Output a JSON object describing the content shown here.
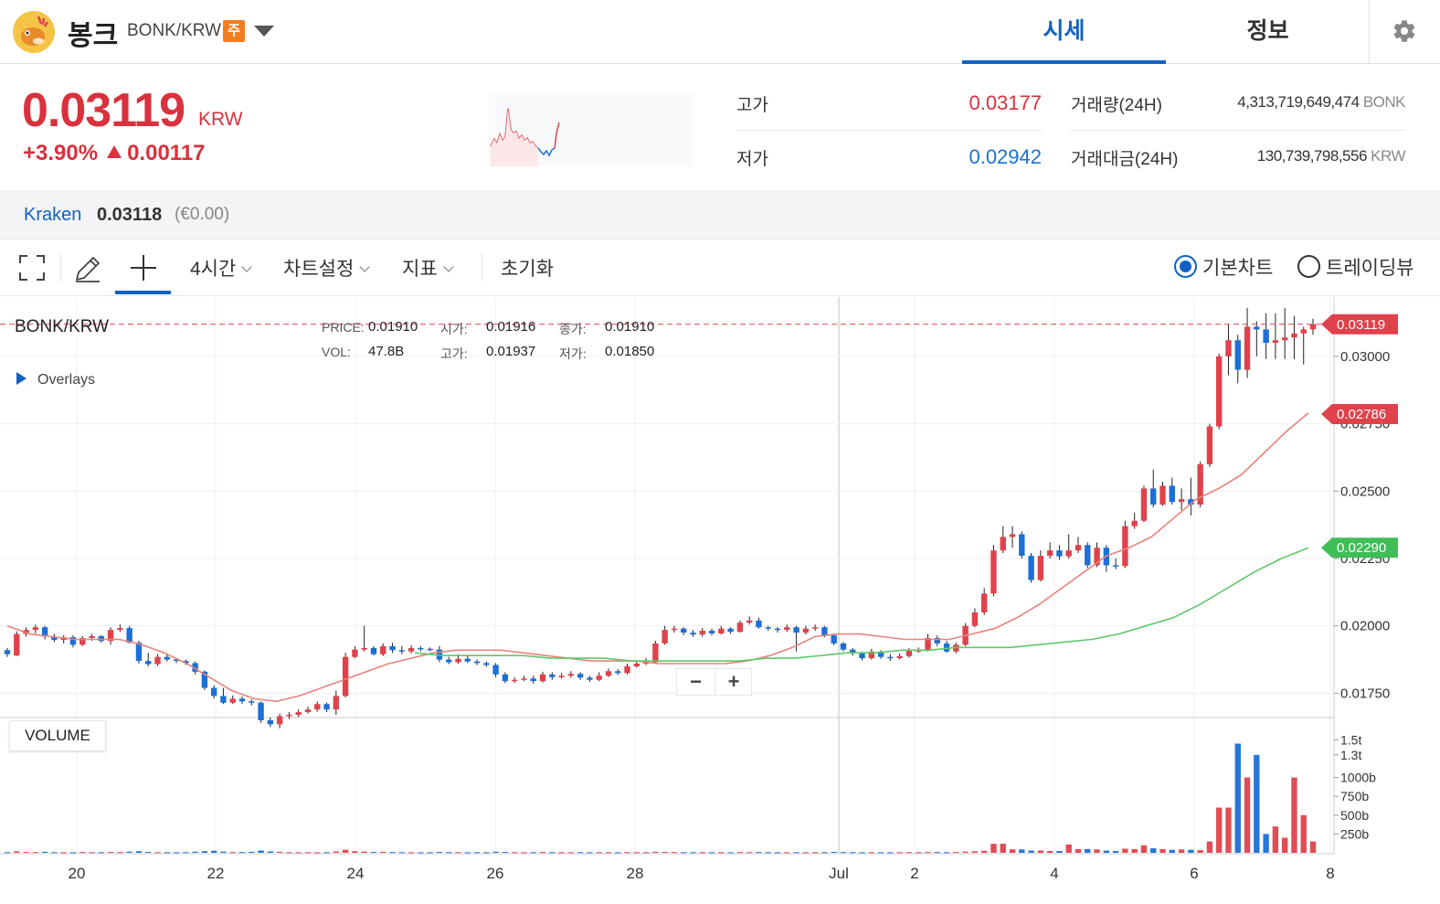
{
  "header": {
    "coin_name": "봉크",
    "pair": "BONK/KRW",
    "badge": "주",
    "tabs": [
      {
        "label": "시세",
        "active": true
      },
      {
        "label": "정보",
        "active": false
      }
    ]
  },
  "price": {
    "current": "0.03119",
    "unit": "KRW",
    "change_pct": "+3.90%",
    "change_amt": "0.00117",
    "high_label": "고가",
    "high": "0.03177",
    "low_label": "저가",
    "low": "0.02942",
    "volume_label": "거래량(24H)",
    "volume": "4,313,719,649,474",
    "volume_unit": "BONK",
    "turnover_label": "거래대금(24H)",
    "turnover": "130,739,798,556",
    "turnover_unit": "KRW"
  },
  "exchange": {
    "name": "Kraken",
    "price": "0.03118",
    "diff": "(€0.00)"
  },
  "toolbar": {
    "interval": "4시간",
    "chart_settings": "차트설정",
    "indicators": "지표",
    "reset": "초기화",
    "basic_chart": "기본차트",
    "tradingview": "트레이딩뷰"
  },
  "chart_legend": {
    "symbol": "BONK/KRW",
    "price_label": "PRICE:",
    "price": "0.01910",
    "open_label": "시가:",
    "open": "0.01916",
    "close_label": "종가:",
    "close": "0.01910",
    "vol_label": "VOL:",
    "vol": "47.8B",
    "high_label": "고가:",
    "high": "0.01937",
    "low_label": "저가:",
    "low": "0.01850",
    "overlays": "Overlays",
    "volume_panel": "VOLUME"
  },
  "colors": {
    "up": "#e0424c",
    "down": "#1c6fd8",
    "ma_short": "#e8837c",
    "ma_long": "#5fc86a",
    "accent": "#1261c4"
  },
  "chart_data": {
    "type": "candlestick",
    "ylim": [
      0.0166,
      0.0322
    ],
    "price_ticks": [
      "0.03000",
      "0.02750",
      "0.02500",
      "0.02250",
      "0.02000",
      "0.01750"
    ],
    "price_tick_values": [
      0.03,
      0.0275,
      0.025,
      0.0225,
      0.02,
      0.0175
    ],
    "price_tags": [
      {
        "label": "0.03119",
        "value": 0.03119,
        "color": "#e0424c"
      },
      {
        "label": "0.02786",
        "value": 0.02786,
        "color": "#e0424c"
      },
      {
        "label": "0.02290",
        "value": 0.0229,
        "color": "#3fbe58"
      }
    ],
    "x_labels": [
      "20",
      "22",
      "24",
      "26",
      "28",
      "Jul",
      "2",
      "4",
      "6",
      "8"
    ],
    "volume_ticks": [
      "1.5t",
      "1.3t",
      "1000b",
      "750b",
      "500b",
      "250b"
    ],
    "volume_tick_values": [
      1500,
      1300,
      1000,
      750,
      500,
      250
    ],
    "candles": [
      [
        0.0191,
        0.01895,
        0.01918,
        0.01885,
        8
      ],
      [
        0.0189,
        0.0197,
        0.0198,
        0.01888,
        20
      ],
      [
        0.0197,
        0.01985,
        0.01995,
        0.0196,
        12
      ],
      [
        0.01985,
        0.01995,
        0.02005,
        0.01972,
        10
      ],
      [
        0.01995,
        0.0196,
        0.02,
        0.0195,
        14
      ],
      [
        0.0196,
        0.01948,
        0.0197,
        0.0194,
        9
      ],
      [
        0.01948,
        0.01958,
        0.01965,
        0.01935,
        8
      ],
      [
        0.01958,
        0.0193,
        0.01965,
        0.0192,
        7
      ],
      [
        0.0193,
        0.01955,
        0.01962,
        0.01925,
        11
      ],
      [
        0.01955,
        0.01962,
        0.0197,
        0.01945,
        9
      ],
      [
        0.01962,
        0.01944,
        0.01966,
        0.01938,
        8
      ],
      [
        0.01944,
        0.01985,
        0.01995,
        0.0193,
        12
      ],
      [
        0.01985,
        0.01992,
        0.02005,
        0.01978,
        10
      ],
      [
        0.01992,
        0.01938,
        0.02,
        0.01935,
        15
      ],
      [
        0.01938,
        0.0187,
        0.01945,
        0.0186,
        22
      ],
      [
        0.0187,
        0.01858,
        0.019,
        0.0185,
        12
      ],
      [
        0.01858,
        0.01885,
        0.01895,
        0.01852,
        9
      ],
      [
        0.01885,
        0.01875,
        0.01895,
        0.01868,
        8
      ],
      [
        0.01875,
        0.0187,
        0.0188,
        0.01862,
        7
      ],
      [
        0.0187,
        0.01862,
        0.01875,
        0.01855,
        9
      ],
      [
        0.01862,
        0.0183,
        0.01868,
        0.0182,
        15
      ],
      [
        0.0183,
        0.0177,
        0.01835,
        0.01762,
        22
      ],
      [
        0.0177,
        0.0174,
        0.0178,
        0.0173,
        28
      ],
      [
        0.0174,
        0.01715,
        0.0177,
        0.0171,
        16
      ],
      [
        0.01715,
        0.0173,
        0.01742,
        0.0171,
        10
      ],
      [
        0.0173,
        0.0172,
        0.01738,
        0.0171,
        11
      ],
      [
        0.0172,
        0.01715,
        0.01728,
        0.01705,
        13
      ],
      [
        0.01715,
        0.0165,
        0.0172,
        0.0164,
        30
      ],
      [
        0.0165,
        0.01635,
        0.0166,
        0.01625,
        18
      ],
      [
        0.01635,
        0.01665,
        0.01675,
        0.0162,
        14
      ],
      [
        0.01665,
        0.0167,
        0.0168,
        0.01655,
        9
      ],
      [
        0.0167,
        0.0168,
        0.0169,
        0.01662,
        8
      ],
      [
        0.0168,
        0.0169,
        0.017,
        0.01675,
        9
      ],
      [
        0.0169,
        0.0171,
        0.0172,
        0.01682,
        7
      ],
      [
        0.0171,
        0.0169,
        0.01715,
        0.0168,
        8
      ],
      [
        0.0169,
        0.0174,
        0.0176,
        0.0167,
        18
      ],
      [
        0.0174,
        0.01885,
        0.019,
        0.01735,
        40
      ],
      [
        0.01885,
        0.01912,
        0.01925,
        0.0188,
        22
      ],
      [
        0.01912,
        0.01918,
        0.02,
        0.01905,
        16
      ],
      [
        0.01918,
        0.01895,
        0.01925,
        0.0189,
        12
      ],
      [
        0.01895,
        0.01925,
        0.01935,
        0.01888,
        14
      ],
      [
        0.01925,
        0.0191,
        0.01937,
        0.019,
        11
      ],
      [
        0.0191,
        0.01905,
        0.01925,
        0.01895,
        9
      ],
      [
        0.01905,
        0.01918,
        0.01928,
        0.01898,
        8
      ],
      [
        0.01918,
        0.01915,
        0.01925,
        0.01905,
        7
      ],
      [
        0.01915,
        0.01912,
        0.0192,
        0.01905,
        8
      ],
      [
        0.01912,
        0.01875,
        0.01925,
        0.01865,
        12
      ],
      [
        0.01875,
        0.01865,
        0.01885,
        0.01858,
        9
      ],
      [
        0.01865,
        0.01878,
        0.01895,
        0.0186,
        10
      ],
      [
        0.01878,
        0.01868,
        0.0189,
        0.01862,
        8
      ],
      [
        0.01868,
        0.01862,
        0.01875,
        0.01855,
        9
      ],
      [
        0.01862,
        0.01855,
        0.01868,
        0.01848,
        8
      ],
      [
        0.01855,
        0.0182,
        0.01862,
        0.0181,
        15
      ],
      [
        0.0182,
        0.01795,
        0.01828,
        0.01788,
        12
      ],
      [
        0.01795,
        0.018,
        0.0181,
        0.01788,
        9
      ],
      [
        0.018,
        0.01805,
        0.01815,
        0.01795,
        8
      ],
      [
        0.01805,
        0.01795,
        0.01815,
        0.01785,
        9
      ],
      [
        0.01795,
        0.0182,
        0.0183,
        0.0179,
        11
      ],
      [
        0.0182,
        0.0181,
        0.01828,
        0.018,
        9
      ],
      [
        0.0181,
        0.01815,
        0.01825,
        0.01805,
        8
      ],
      [
        0.01815,
        0.01822,
        0.01832,
        0.01808,
        8
      ],
      [
        0.01822,
        0.01808,
        0.01828,
        0.018,
        9
      ],
      [
        0.01808,
        0.018,
        0.01815,
        0.01792,
        8
      ],
      [
        0.018,
        0.01815,
        0.01828,
        0.01795,
        9
      ],
      [
        0.01815,
        0.01832,
        0.01842,
        0.0181,
        8
      ],
      [
        0.01832,
        0.01825,
        0.0184,
        0.01818,
        7
      ],
      [
        0.01825,
        0.0185,
        0.0186,
        0.0182,
        10
      ],
      [
        0.0185,
        0.0186,
        0.0187,
        0.01845,
        9
      ],
      [
        0.0186,
        0.01865,
        0.0188,
        0.01855,
        8
      ],
      [
        0.01865,
        0.01935,
        0.01945,
        0.0186,
        14
      ],
      [
        0.01935,
        0.01985,
        0.02,
        0.0193,
        12
      ],
      [
        0.01985,
        0.0199,
        0.02,
        0.01975,
        10
      ],
      [
        0.0199,
        0.01975,
        0.01995,
        0.01965,
        9
      ],
      [
        0.01975,
        0.01968,
        0.01985,
        0.0196,
        8
      ],
      [
        0.01968,
        0.01982,
        0.01992,
        0.0196,
        9
      ],
      [
        0.01982,
        0.01972,
        0.0199,
        0.01965,
        8
      ],
      [
        0.01972,
        0.0199,
        0.02,
        0.01968,
        9
      ],
      [
        0.0199,
        0.01978,
        0.01995,
        0.0197,
        7
      ],
      [
        0.01978,
        0.02012,
        0.0202,
        0.01975,
        10
      ],
      [
        0.02012,
        0.0202,
        0.02035,
        0.02005,
        9
      ],
      [
        0.0202,
        0.01995,
        0.0203,
        0.0199,
        11
      ],
      [
        0.01995,
        0.0199,
        0.02,
        0.01982,
        8
      ],
      [
        0.0199,
        0.01985,
        0.01995,
        0.01975,
        7
      ],
      [
        0.01985,
        0.01995,
        0.02005,
        0.01978,
        8
      ],
      [
        0.01995,
        0.01975,
        0.02,
        0.01905,
        9
      ],
      [
        0.01975,
        0.0199,
        0.02,
        0.01968,
        7
      ],
      [
        0.0199,
        0.01995,
        0.02005,
        0.01982,
        8
      ],
      [
        0.01995,
        0.01965,
        0.02,
        0.01958,
        9
      ],
      [
        0.01965,
        0.01935,
        0.01972,
        0.01928,
        12
      ],
      [
        0.01935,
        0.01912,
        0.0194,
        0.01905,
        11
      ],
      [
        0.01912,
        0.01898,
        0.01918,
        0.0189,
        9
      ],
      [
        0.01898,
        0.0188,
        0.01905,
        0.01872,
        8
      ],
      [
        0.0188,
        0.01905,
        0.01915,
        0.01875,
        9
      ],
      [
        0.01905,
        0.01885,
        0.0191,
        0.01878,
        8
      ],
      [
        0.01885,
        0.0188,
        0.01895,
        0.0187,
        7
      ],
      [
        0.0188,
        0.01888,
        0.01898,
        0.01875,
        8
      ],
      [
        0.01888,
        0.01908,
        0.01918,
        0.01882,
        9
      ],
      [
        0.01908,
        0.0191,
        0.0192,
        0.019,
        8
      ],
      [
        0.0191,
        0.01955,
        0.0197,
        0.01905,
        11
      ],
      [
        0.01955,
        0.01935,
        0.01965,
        0.01925,
        10
      ],
      [
        0.01935,
        0.01905,
        0.01945,
        0.019,
        9
      ],
      [
        0.01905,
        0.0193,
        0.01938,
        0.01898,
        11
      ],
      [
        0.0193,
        0.02,
        0.0201,
        0.01925,
        16
      ],
      [
        0.02,
        0.0205,
        0.02065,
        0.01995,
        20
      ],
      [
        0.0205,
        0.0212,
        0.0214,
        0.0204,
        28
      ],
      [
        0.0212,
        0.0228,
        0.023,
        0.0211,
        120
      ],
      [
        0.0228,
        0.0233,
        0.0237,
        0.0227,
        120
      ],
      [
        0.0233,
        0.0234,
        0.0237,
        0.0229,
        45
      ],
      [
        0.0234,
        0.0226,
        0.0235,
        0.0225,
        45
      ],
      [
        0.0226,
        0.0217,
        0.0227,
        0.0216,
        30
      ],
      [
        0.0217,
        0.0226,
        0.0228,
        0.02165,
        30
      ],
      [
        0.0226,
        0.0228,
        0.0231,
        0.0225,
        25
      ],
      [
        0.0228,
        0.02258,
        0.023,
        0.02245,
        24
      ],
      [
        0.02258,
        0.0228,
        0.0234,
        0.0225,
        110
      ],
      [
        0.0228,
        0.023,
        0.0233,
        0.0227,
        50
      ],
      [
        0.023,
        0.02225,
        0.0231,
        0.02215,
        50
      ],
      [
        0.02225,
        0.0229,
        0.0231,
        0.02218,
        45
      ],
      [
        0.0229,
        0.02225,
        0.023,
        0.022,
        30
      ],
      [
        0.02225,
        0.02222,
        0.0225,
        0.0221,
        25
      ],
      [
        0.02222,
        0.0237,
        0.0239,
        0.02215,
        55
      ],
      [
        0.0237,
        0.0239,
        0.0242,
        0.0236,
        50
      ],
      [
        0.0239,
        0.0251,
        0.0252,
        0.02385,
        100
      ],
      [
        0.0251,
        0.0245,
        0.0258,
        0.0244,
        60
      ],
      [
        0.0245,
        0.0252,
        0.02535,
        0.02445,
        50
      ],
      [
        0.0252,
        0.0246,
        0.0255,
        0.0245,
        40
      ],
      [
        0.0246,
        0.0247,
        0.0251,
        0.0243,
        45
      ],
      [
        0.0247,
        0.0245,
        0.0255,
        0.0241,
        40
      ],
      [
        0.0245,
        0.026,
        0.0261,
        0.0244,
        35
      ],
      [
        0.026,
        0.0274,
        0.0275,
        0.0259,
        150
      ],
      [
        0.0274,
        0.03,
        0.0301,
        0.0273,
        600
      ],
      [
        0.03,
        0.0306,
        0.0312,
        0.0293,
        600
      ],
      [
        0.0306,
        0.0295,
        0.0308,
        0.029,
        1450
      ],
      [
        0.0295,
        0.0311,
        0.0318,
        0.0292,
        1000
      ],
      [
        0.0311,
        0.031,
        0.0313,
        0.03,
        1300
      ],
      [
        0.031,
        0.0305,
        0.0316,
        0.0299,
        250
      ],
      [
        0.0305,
        0.0306,
        0.0316,
        0.0299,
        350
      ],
      [
        0.0306,
        0.0307,
        0.0318,
        0.0299,
        200
      ],
      [
        0.0307,
        0.03085,
        0.0315,
        0.0299,
        1000
      ],
      [
        0.03085,
        0.031,
        0.0311,
        0.0297,
        500
      ],
      [
        0.031,
        0.03119,
        0.0314,
        0.0308,
        150
      ]
    ],
    "ma_short": [
      0.02,
      0.0197,
      0.0196,
      0.0195,
      0.0195,
      0.0195,
      0.0193,
      0.019,
      0.0186,
      0.0181,
      0.0176,
      0.0173,
      0.0172,
      0.0174,
      0.0177,
      0.018,
      0.0183,
      0.0186,
      0.0188,
      0.019,
      0.0191,
      0.0191,
      0.0191,
      0.019,
      0.0189,
      0.0188,
      0.0187,
      0.0187,
      0.0187,
      0.0186,
      0.0186,
      0.0186,
      0.0186,
      0.0187,
      0.0189,
      0.0192,
      0.0196,
      0.0197,
      0.0197,
      0.0196,
      0.0195,
      0.0195,
      0.0195,
      0.0197,
      0.0199,
      0.0203,
      0.0208,
      0.0214,
      0.022,
      0.0226,
      0.0229,
      0.0233,
      0.024,
      0.0247,
      0.0251,
      0.0256,
      0.0264,
      0.0272,
      0.0279
    ],
    "ma_long": [
      0.019,
      0.0189,
      0.0189,
      0.0189,
      0.0189,
      0.0188,
      0.0188,
      0.0188,
      0.0187,
      0.0187,
      0.0187,
      0.0187,
      0.0187,
      0.0188,
      0.0188,
      0.0189,
      0.019,
      0.019,
      0.0191,
      0.0191,
      0.0192,
      0.0192,
      0.0192,
      0.0193,
      0.0194,
      0.0195,
      0.0197,
      0.02,
      0.0203,
      0.0208,
      0.0214,
      0.022,
      0.0225,
      0.0229
    ],
    "volume_scale_max": 1650
  }
}
